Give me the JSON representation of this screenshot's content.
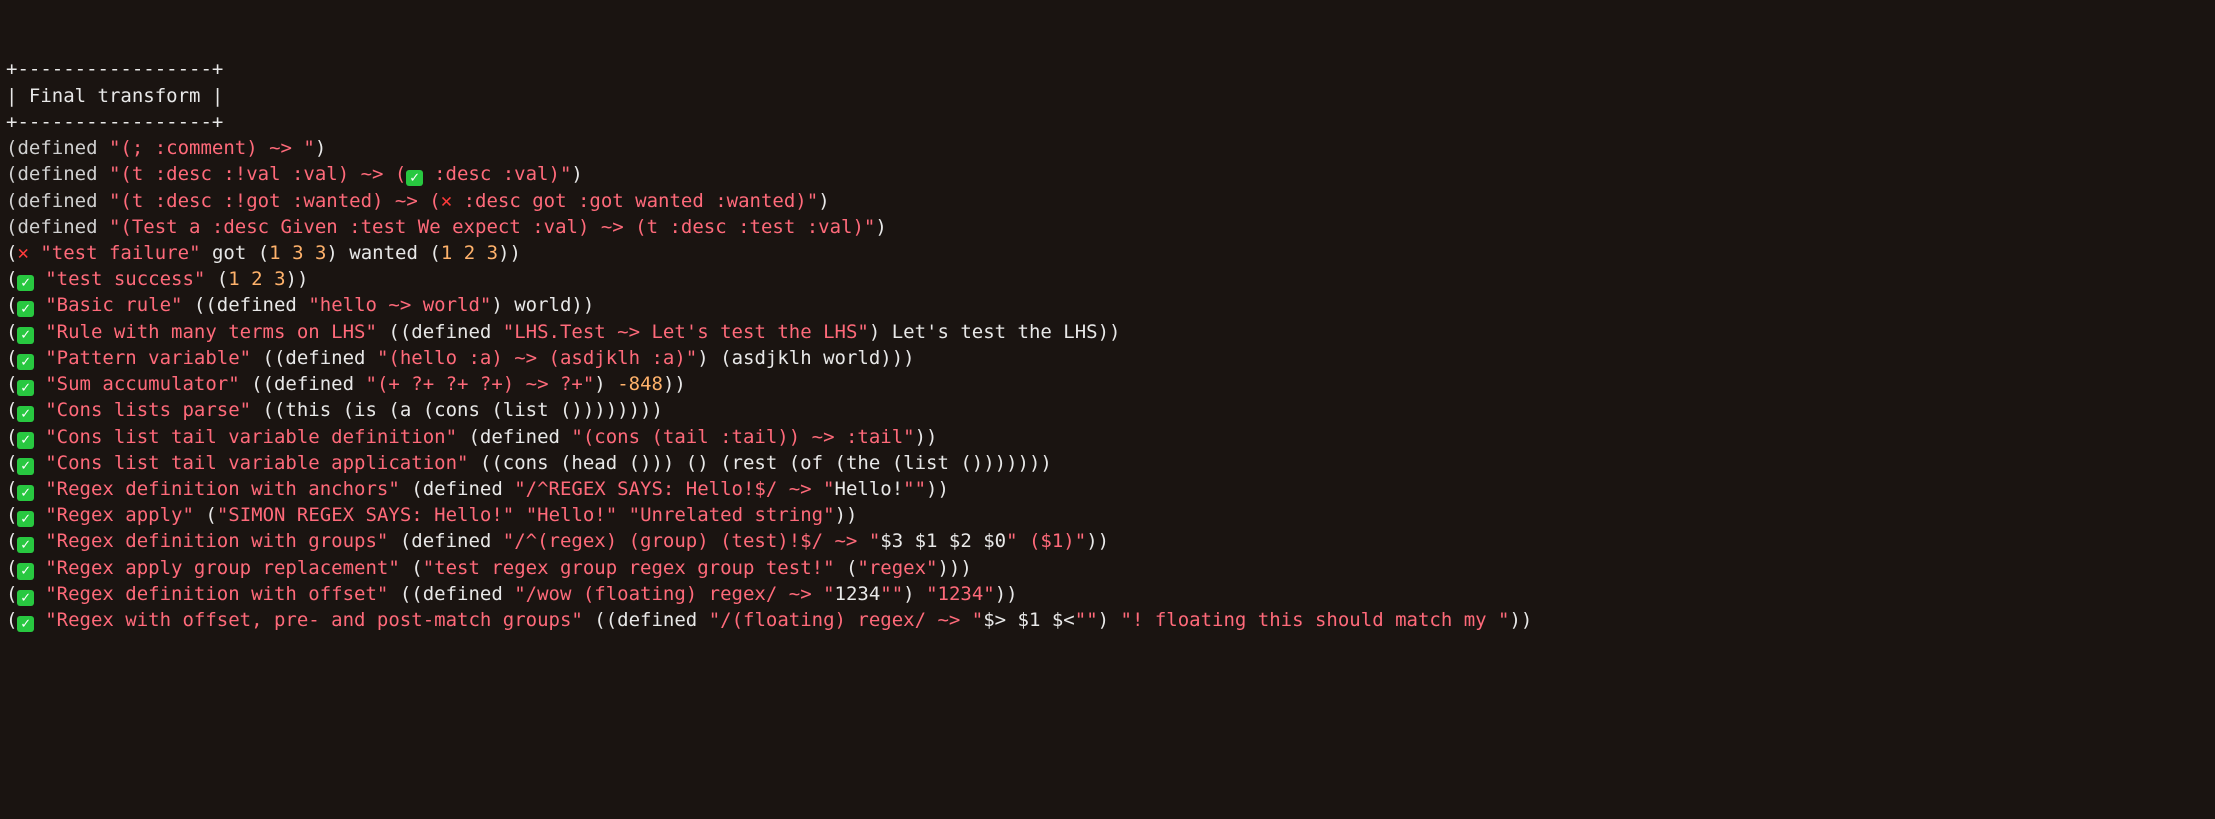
{
  "header": {
    "border_top": "+-----------------+",
    "title_line": "| Final transform |",
    "border_bottom": "+-----------------+"
  },
  "icons": {
    "check_glyph": "✓",
    "cross_glyph": "✕"
  },
  "definitions": [
    {
      "prefix": "(defined ",
      "string": "\"(; :comment) ~> \"",
      "suffix": ")"
    },
    {
      "prefix": "(defined ",
      "string_pre": "\"(t :desc :!val :val) ~> (",
      "inline_icon": "check",
      "string_post": " :desc :val)\"",
      "suffix": ")"
    },
    {
      "prefix": "(defined ",
      "string_pre": "\"(t :desc :!got :wanted) ~> (",
      "inline_icon": "cross",
      "string_post": " :desc got :got wanted :wanted)\"",
      "suffix": ")"
    },
    {
      "prefix": "(defined ",
      "string": "\"(Test a :desc Given :test We expect :val) ~> (t :desc :test :val)\"",
      "suffix": ")"
    }
  ],
  "results": [
    {
      "icon": "cross",
      "parts": [
        {
          "t": "paren",
          "v": "("
        },
        {
          "t": "icon"
        },
        {
          "t": "plain",
          "v": " "
        },
        {
          "t": "str",
          "v": "\"test failure\""
        },
        {
          "t": "plain",
          "v": " got ("
        },
        {
          "t": "num",
          "v": "1"
        },
        {
          "t": "plain",
          "v": " "
        },
        {
          "t": "num",
          "v": "3"
        },
        {
          "t": "plain",
          "v": " "
        },
        {
          "t": "num",
          "v": "3"
        },
        {
          "t": "plain",
          "v": ") wanted ("
        },
        {
          "t": "num",
          "v": "1"
        },
        {
          "t": "plain",
          "v": " "
        },
        {
          "t": "num",
          "v": "2"
        },
        {
          "t": "plain",
          "v": " "
        },
        {
          "t": "num",
          "v": "3"
        },
        {
          "t": "plain",
          "v": "))"
        }
      ]
    },
    {
      "icon": "check",
      "parts": [
        {
          "t": "paren",
          "v": "("
        },
        {
          "t": "icon"
        },
        {
          "t": "plain",
          "v": " "
        },
        {
          "t": "str",
          "v": "\"test success\""
        },
        {
          "t": "plain",
          "v": " ("
        },
        {
          "t": "num",
          "v": "1"
        },
        {
          "t": "plain",
          "v": " "
        },
        {
          "t": "num",
          "v": "2"
        },
        {
          "t": "plain",
          "v": " "
        },
        {
          "t": "num",
          "v": "3"
        },
        {
          "t": "plain",
          "v": "))"
        }
      ]
    },
    {
      "icon": "check",
      "parts": [
        {
          "t": "paren",
          "v": "("
        },
        {
          "t": "icon"
        },
        {
          "t": "plain",
          "v": " "
        },
        {
          "t": "str",
          "v": "\"Basic rule\""
        },
        {
          "t": "plain",
          "v": " ((defined "
        },
        {
          "t": "str",
          "v": "\"hello ~> world\""
        },
        {
          "t": "plain",
          "v": ") world))"
        }
      ]
    },
    {
      "icon": "check",
      "parts": [
        {
          "t": "paren",
          "v": "("
        },
        {
          "t": "icon"
        },
        {
          "t": "plain",
          "v": " "
        },
        {
          "t": "str",
          "v": "\"Rule with many terms on LHS\""
        },
        {
          "t": "plain",
          "v": " ((defined "
        },
        {
          "t": "str",
          "v": "\"LHS.Test ~> Let's test the LHS\""
        },
        {
          "t": "plain",
          "v": ") Let's test the LHS))"
        }
      ]
    },
    {
      "icon": "check",
      "parts": [
        {
          "t": "paren",
          "v": "("
        },
        {
          "t": "icon"
        },
        {
          "t": "plain",
          "v": " "
        },
        {
          "t": "str",
          "v": "\"Pattern variable\""
        },
        {
          "t": "plain",
          "v": " ((defined "
        },
        {
          "t": "str",
          "v": "\"(hello :a) ~> (asdjklh :a)\""
        },
        {
          "t": "plain",
          "v": ") (asdjklh world)))"
        }
      ]
    },
    {
      "icon": "check",
      "parts": [
        {
          "t": "paren",
          "v": "("
        },
        {
          "t": "icon"
        },
        {
          "t": "plain",
          "v": " "
        },
        {
          "t": "str",
          "v": "\"Sum accumulator\""
        },
        {
          "t": "plain",
          "v": " ((defined "
        },
        {
          "t": "str",
          "v": "\"(+ ?+ ?+ ?+) ~> ?+\""
        },
        {
          "t": "plain",
          "v": ") "
        },
        {
          "t": "num",
          "v": "-848"
        },
        {
          "t": "plain",
          "v": "))"
        }
      ]
    },
    {
      "icon": "check",
      "parts": [
        {
          "t": "paren",
          "v": "("
        },
        {
          "t": "icon"
        },
        {
          "t": "plain",
          "v": " "
        },
        {
          "t": "str",
          "v": "\"Cons lists parse\""
        },
        {
          "t": "plain",
          "v": " ((this (is (a (cons (list ())))))))"
        }
      ]
    },
    {
      "icon": "check",
      "parts": [
        {
          "t": "paren",
          "v": "("
        },
        {
          "t": "icon"
        },
        {
          "t": "plain",
          "v": " "
        },
        {
          "t": "str",
          "v": "\"Cons list tail variable definition\""
        },
        {
          "t": "plain",
          "v": " (defined "
        },
        {
          "t": "str",
          "v": "\"(cons (tail :tail)) ~> :tail\""
        },
        {
          "t": "plain",
          "v": "))"
        }
      ]
    },
    {
      "icon": "check",
      "parts": [
        {
          "t": "paren",
          "v": "("
        },
        {
          "t": "icon"
        },
        {
          "t": "plain",
          "v": " "
        },
        {
          "t": "str",
          "v": "\"Cons list tail variable application\""
        },
        {
          "t": "plain",
          "v": " ((cons (head ())) () (rest (of (the (list ()))))))"
        }
      ]
    },
    {
      "icon": "check",
      "parts": [
        {
          "t": "paren",
          "v": "("
        },
        {
          "t": "icon"
        },
        {
          "t": "plain",
          "v": " "
        },
        {
          "t": "str",
          "v": "\"Regex definition with anchors\""
        },
        {
          "t": "plain",
          "v": " (defined "
        },
        {
          "t": "str",
          "v": "\"/^REGEX SAYS: Hello!$/ ~> \""
        },
        {
          "t": "plain",
          "v": "Hello!"
        },
        {
          "t": "str",
          "v": "\"\""
        },
        {
          "t": "plain",
          "v": "))"
        }
      ]
    },
    {
      "icon": "check",
      "parts": [
        {
          "t": "paren",
          "v": "("
        },
        {
          "t": "icon"
        },
        {
          "t": "plain",
          "v": " "
        },
        {
          "t": "str",
          "v": "\"Regex apply\""
        },
        {
          "t": "plain",
          "v": " ("
        },
        {
          "t": "str",
          "v": "\"SIMON REGEX SAYS: Hello!\""
        },
        {
          "t": "plain",
          "v": " "
        },
        {
          "t": "str",
          "v": "\"Hello!\""
        },
        {
          "t": "plain",
          "v": " "
        },
        {
          "t": "str",
          "v": "\"Unrelated string\""
        },
        {
          "t": "plain",
          "v": "))"
        }
      ]
    },
    {
      "icon": "check",
      "parts": [
        {
          "t": "paren",
          "v": "("
        },
        {
          "t": "icon"
        },
        {
          "t": "plain",
          "v": " "
        },
        {
          "t": "str",
          "v": "\"Regex definition with groups\""
        },
        {
          "t": "plain",
          "v": " (defined "
        },
        {
          "t": "str",
          "v": "\"/^(regex) (group) (test)!$/ ~> \""
        },
        {
          "t": "plain",
          "v": "$3 $1 $2 $0"
        },
        {
          "t": "str",
          "v": "\" ($1)\""
        },
        {
          "t": "plain",
          "v": "))"
        }
      ]
    },
    {
      "icon": "check",
      "parts": [
        {
          "t": "paren",
          "v": "("
        },
        {
          "t": "icon"
        },
        {
          "t": "plain",
          "v": " "
        },
        {
          "t": "str",
          "v": "\"Regex apply group replacement\""
        },
        {
          "t": "plain",
          "v": " ("
        },
        {
          "t": "str",
          "v": "\"test regex group regex group test!\""
        },
        {
          "t": "plain",
          "v": " ("
        },
        {
          "t": "str",
          "v": "\"regex\""
        },
        {
          "t": "plain",
          "v": ")))"
        }
      ]
    },
    {
      "icon": "check",
      "parts": [
        {
          "t": "paren",
          "v": "("
        },
        {
          "t": "icon"
        },
        {
          "t": "plain",
          "v": " "
        },
        {
          "t": "str",
          "v": "\"Regex definition with offset\""
        },
        {
          "t": "plain",
          "v": " ((defined "
        },
        {
          "t": "str",
          "v": "\"/wow (floating) regex/ ~> \""
        },
        {
          "t": "plain",
          "v": "1234"
        },
        {
          "t": "str",
          "v": "\"\""
        },
        {
          "t": "plain",
          "v": ") "
        },
        {
          "t": "str",
          "v": "\"1234\""
        },
        {
          "t": "plain",
          "v": "))"
        }
      ]
    },
    {
      "icon": "check",
      "parts": [
        {
          "t": "paren",
          "v": "("
        },
        {
          "t": "icon"
        },
        {
          "t": "plain",
          "v": " "
        },
        {
          "t": "str",
          "v": "\"Regex with offset, pre- and post-match groups\""
        },
        {
          "t": "plain",
          "v": " ((defined "
        },
        {
          "t": "str",
          "v": "\"/(floating) regex/ ~> \""
        },
        {
          "t": "plain",
          "v": "$> $1 $<"
        },
        {
          "t": "str",
          "v": "\"\""
        },
        {
          "t": "plain",
          "v": ") "
        },
        {
          "t": "str",
          "v": "\"! floating this should match my \""
        },
        {
          "t": "plain",
          "v": "))"
        }
      ]
    }
  ]
}
